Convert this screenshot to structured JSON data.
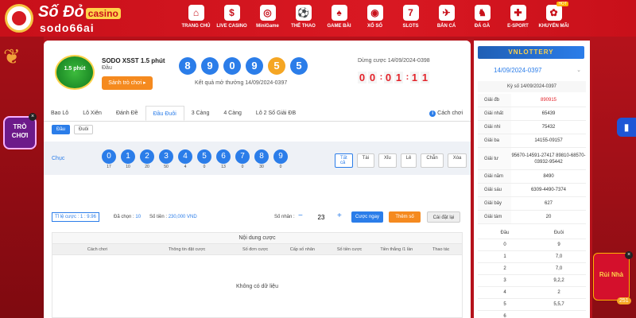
{
  "brand": {
    "name": "Số Đỏ",
    "tag": "casino",
    "domain": "sodo66ai"
  },
  "nav": [
    {
      "label": "TRANG CHỦ",
      "icon": "home-icon",
      "glyph": "⌂",
      "hot": ""
    },
    {
      "label": "LIVE CASINO",
      "icon": "chip-icon",
      "glyph": "$",
      "hot": ""
    },
    {
      "label": "MiniGame",
      "icon": "roulette-icon",
      "glyph": "◎",
      "hot": ""
    },
    {
      "label": "THỂ THAO",
      "icon": "ball-icon",
      "glyph": "⚽",
      "hot": ""
    },
    {
      "label": "GAME BÀI",
      "icon": "cards-icon",
      "glyph": "♠",
      "hot": ""
    },
    {
      "label": "XỔ SỐ",
      "icon": "lottery-icon",
      "glyph": "◉",
      "hot": ""
    },
    {
      "label": "SLOTS",
      "icon": "slot-icon",
      "glyph": "7",
      "hot": ""
    },
    {
      "label": "BẮN CÁ",
      "icon": "fish-icon",
      "glyph": "✈",
      "hot": ""
    },
    {
      "label": "ĐÁ GÀ",
      "icon": "rooster-icon",
      "glyph": "♞",
      "hot": ""
    },
    {
      "label": "E-SPORT",
      "icon": "gamepad-icon",
      "glyph": "✚",
      "hot": ""
    },
    {
      "label": "KHUYẾN MÃI",
      "icon": "gift-icon",
      "glyph": "✿",
      "hot": "HOT"
    }
  ],
  "side": {
    "tro_choi": "TRÒ CHƠI",
    "close": "×",
    "runha": "Rủi Nhà",
    "badge": "251"
  },
  "game": {
    "logo_text": "1.5 phút",
    "title": "SODO XSST 1.5 phút",
    "sub": "Đầu",
    "play_label": "Sảnh trò chơi ▸",
    "balls": [
      "8",
      "9",
      "0",
      "9",
      "5",
      "5"
    ],
    "orange_index": 4,
    "last_result": "Kết quả mở thưởng 14/09/2024-0397",
    "stop_label": "Dừng cược 14/09/2024-0398",
    "timer": [
      "0",
      "0",
      "0",
      "1",
      "1",
      "1"
    ]
  },
  "tabs": [
    "Bao Lô",
    "Lô Xiên",
    "Đánh Đề",
    "Đầu Đuôi",
    "3 Càng",
    "4 Càng",
    "Lô 2 Số Giải ĐB"
  ],
  "active_tab": 3,
  "help": "Cách chơi",
  "subtabs": [
    "Đầu",
    "Đuôi"
  ],
  "pick": {
    "label": "Chục",
    "nums": [
      {
        "n": "0",
        "c": "17"
      },
      {
        "n": "1",
        "c": "10"
      },
      {
        "n": "2",
        "c": "20"
      },
      {
        "n": "3",
        "c": "50"
      },
      {
        "n": "4",
        "c": "4"
      },
      {
        "n": "5",
        "c": "0"
      },
      {
        "n": "6",
        "c": "13"
      },
      {
        "n": "7",
        "c": "0"
      },
      {
        "n": "8",
        "c": "30"
      },
      {
        "n": "9",
        "c": "0"
      }
    ],
    "filters": [
      "Tất cả",
      "Tài",
      "Xỉu",
      "Lẻ",
      "Chẵn",
      "Xóa"
    ]
  },
  "bet": {
    "rate": "Tỉ lệ cược : 1 : 9.96",
    "sel_label": "Đã chọn : ",
    "sel_val": "10",
    "money_label": "Số tiền : ",
    "money_val": "230,000 VND",
    "mul_label": "Số nhân :",
    "minus": "−",
    "mul_value": "23",
    "plus": "+",
    "btn_bet": "Cược ngay",
    "btn_add": "Thêm số",
    "btn_reset": "Cài đặt lại"
  },
  "table": {
    "title": "Nội dung cược",
    "headers": [
      "Cách chơi",
      "Thông tin đặt cược",
      "Số đơn cược",
      "Cấp số nhân",
      "Số tiền cược",
      "Tiền thắng /1 lần",
      "Thao tác"
    ],
    "empty": "Không có dữ liệu"
  },
  "panel": {
    "brand": "VNLOTTERY",
    "date": "14/09/2024-0397",
    "chev": "⌄",
    "kyso": "Kỳ số 14/09/2024-0397",
    "prizes": [
      {
        "name": "Giải đb",
        "value": "890915"
      },
      {
        "name": "Giải nhất",
        "value": "65439"
      },
      {
        "name": "Giải nhì",
        "value": "75432"
      },
      {
        "name": "Giải ba",
        "value": "14155-09157"
      },
      {
        "name": "Giải tư",
        "value": "95670-14591-27417 89810-68570-03932-95442"
      },
      {
        "name": "Giải năm",
        "value": "8490"
      },
      {
        "name": "Giải sáu",
        "value": "6309-4490-7374"
      },
      {
        "name": "Giải bảy",
        "value": "627"
      },
      {
        "name": "Giải tám",
        "value": "20"
      }
    ],
    "dd_head": [
      "Đầu",
      "Đuôi"
    ],
    "dd_rows": [
      [
        "0",
        "9"
      ],
      [
        "1",
        "7,0"
      ],
      [
        "2",
        "7,0"
      ],
      [
        "3",
        "9,2,2"
      ],
      [
        "4",
        "2"
      ],
      [
        "5",
        "5,5,7"
      ],
      [
        "6",
        ""
      ]
    ]
  }
}
